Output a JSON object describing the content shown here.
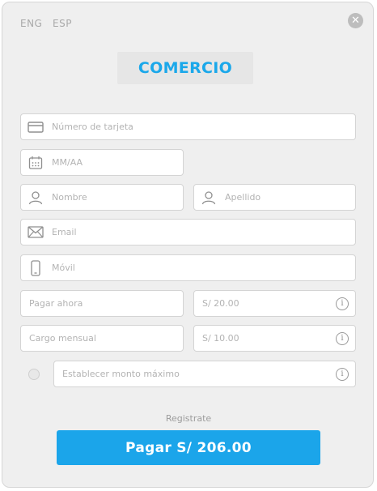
{
  "languages": {
    "eng": "ENG",
    "esp": "ESP"
  },
  "close": {
    "glyph": "✕"
  },
  "brand": {
    "name": "COMERCIO",
    "color": "#1ba8ea"
  },
  "form": {
    "card_number": {
      "placeholder": "Número de tarjeta",
      "icon": "credit-card-icon"
    },
    "expiry": {
      "placeholder": "MM/AA",
      "icon": "calendar-icon"
    },
    "first_name": {
      "placeholder": "Nombre",
      "icon": "user-icon"
    },
    "last_name": {
      "placeholder": "Apellido",
      "icon": "user-icon"
    },
    "email": {
      "placeholder": "Email",
      "icon": "envelope-icon"
    },
    "mobile": {
      "placeholder": "Móvil",
      "icon": "mobile-phone-icon"
    },
    "pay_now": {
      "label": "Pagar ahora",
      "value": "S/ 20.00"
    },
    "monthly_charge": {
      "label": "Cargo mensual",
      "value": "S/ 10.00"
    },
    "max_amount": {
      "label": "Establecer monto máximo"
    },
    "info_glyph": "i"
  },
  "register_label": "Registrate",
  "pay_button": {
    "label": "Pagar S/ 206.00",
    "color": "#1ba5ea"
  }
}
